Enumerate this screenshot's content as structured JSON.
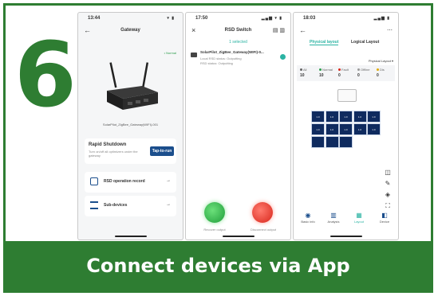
{
  "step_number": "6",
  "caption": "Connect devices via App",
  "colors": {
    "brand_green": "#2e7d32",
    "button_blue": "#1b4e8c",
    "panel_navy": "#0f2b5f",
    "accent_teal": "#2bb3a3"
  },
  "phone1": {
    "time": "13:44",
    "status_icons": "▾ ▮",
    "title": "Gateway",
    "status": "• Normal",
    "device_name": "SolarPilot_ZigBee_Gateway(WIFI)-001",
    "rapid_title": "Rapid Shutdown",
    "rapid_desc": "Turn on/off all optimizers under the gateway",
    "rapid_button": "Tap-to-run",
    "rsd_record": "RSD operation record",
    "sub_devices": "Sub-devices",
    "arrow": "→"
  },
  "phone2": {
    "time": "17:50",
    "status_icons": "▂▄▆ ▾ ▮",
    "title": "RSD Switch",
    "selected": "1 selected",
    "device_name": "SolarPilot_ZigBee_Gateway(WIFI)-0...",
    "line2": "Local RSD status: Outputting",
    "line3": "RSD status: Outputting",
    "recover": "Recover output",
    "disconnect": "Disconnect output"
  },
  "phone3": {
    "time": "18:03",
    "status_icons": "▂▄▆ ▮",
    "tab_active": "Physical layout",
    "tab_inactive": "Logical Layout",
    "layout_select": "Physical Layout ▾",
    "stats": [
      {
        "label": "All",
        "value": "10"
      },
      {
        "label": "Normal",
        "value": "10"
      },
      {
        "label": "Fault",
        "value": "0"
      },
      {
        "label": "Offline",
        "value": "0"
      },
      {
        "label": "Dis",
        "value": "0"
      }
    ],
    "panels": [
      "1.0",
      "1.0",
      "1.0",
      "1.0",
      "1.0",
      "1.0",
      "1.0",
      "1.0",
      "1.0",
      "1.0",
      "",
      "",
      ""
    ],
    "nav": [
      {
        "label": "Basic info",
        "glyph": "◉"
      },
      {
        "label": "Analysis",
        "glyph": "▥"
      },
      {
        "label": "Layout",
        "glyph": "▦"
      },
      {
        "label": "Device",
        "glyph": "◧"
      }
    ]
  }
}
